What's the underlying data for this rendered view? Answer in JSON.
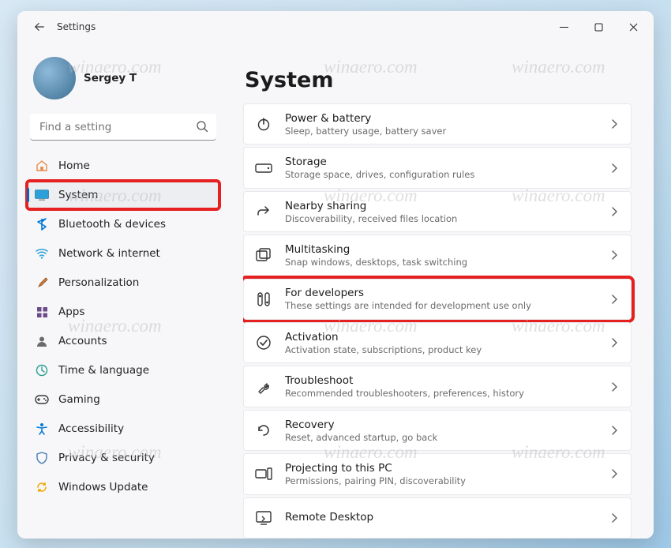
{
  "app_title": "Settings",
  "user": {
    "name": "Sergey T"
  },
  "search": {
    "placeholder": "Find a setting"
  },
  "sidebar": {
    "items": [
      {
        "label": "Home",
        "icon": "home"
      },
      {
        "label": "System",
        "icon": "system",
        "selected": true,
        "highlighted": true
      },
      {
        "label": "Bluetooth & devices",
        "icon": "bluetooth"
      },
      {
        "label": "Network & internet",
        "icon": "network"
      },
      {
        "label": "Personalization",
        "icon": "brush"
      },
      {
        "label": "Apps",
        "icon": "apps"
      },
      {
        "label": "Accounts",
        "icon": "accounts"
      },
      {
        "label": "Time & language",
        "icon": "time"
      },
      {
        "label": "Gaming",
        "icon": "gaming"
      },
      {
        "label": "Accessibility",
        "icon": "accessibility"
      },
      {
        "label": "Privacy & security",
        "icon": "privacy"
      },
      {
        "label": "Windows Update",
        "icon": "update"
      }
    ]
  },
  "page": {
    "title": "System",
    "cards": [
      {
        "title": "Power & battery",
        "sub": "Sleep, battery usage, battery saver",
        "icon": "power"
      },
      {
        "title": "Storage",
        "sub": "Storage space, drives, configuration rules",
        "icon": "storage"
      },
      {
        "title": "Nearby sharing",
        "sub": "Discoverability, received files location",
        "icon": "share"
      },
      {
        "title": "Multitasking",
        "sub": "Snap windows, desktops, task switching",
        "icon": "multitask"
      },
      {
        "title": "For developers",
        "sub": "These settings are intended for development use only",
        "icon": "dev",
        "highlighted": true
      },
      {
        "title": "Activation",
        "sub": "Activation state, subscriptions, product key",
        "icon": "activation"
      },
      {
        "title": "Troubleshoot",
        "sub": "Recommended troubleshooters, preferences, history",
        "icon": "troubleshoot"
      },
      {
        "title": "Recovery",
        "sub": "Reset, advanced startup, go back",
        "icon": "recovery"
      },
      {
        "title": "Projecting to this PC",
        "sub": "Permissions, pairing PIN, discoverability",
        "icon": "project"
      },
      {
        "title": "Remote Desktop",
        "sub": "",
        "icon": "remote"
      }
    ]
  },
  "watermark": "winaero.com",
  "icons": {
    "home": "#e88b4a",
    "bluetooth": "#0078d4",
    "network": "#2aa0d8",
    "apps": "#6b4b8a",
    "time": "#2a9d8f",
    "gaming": "#3a3a3a",
    "accessibility": "#0078d4",
    "privacy": "#4a7ab5",
    "update": "#f0a800"
  }
}
